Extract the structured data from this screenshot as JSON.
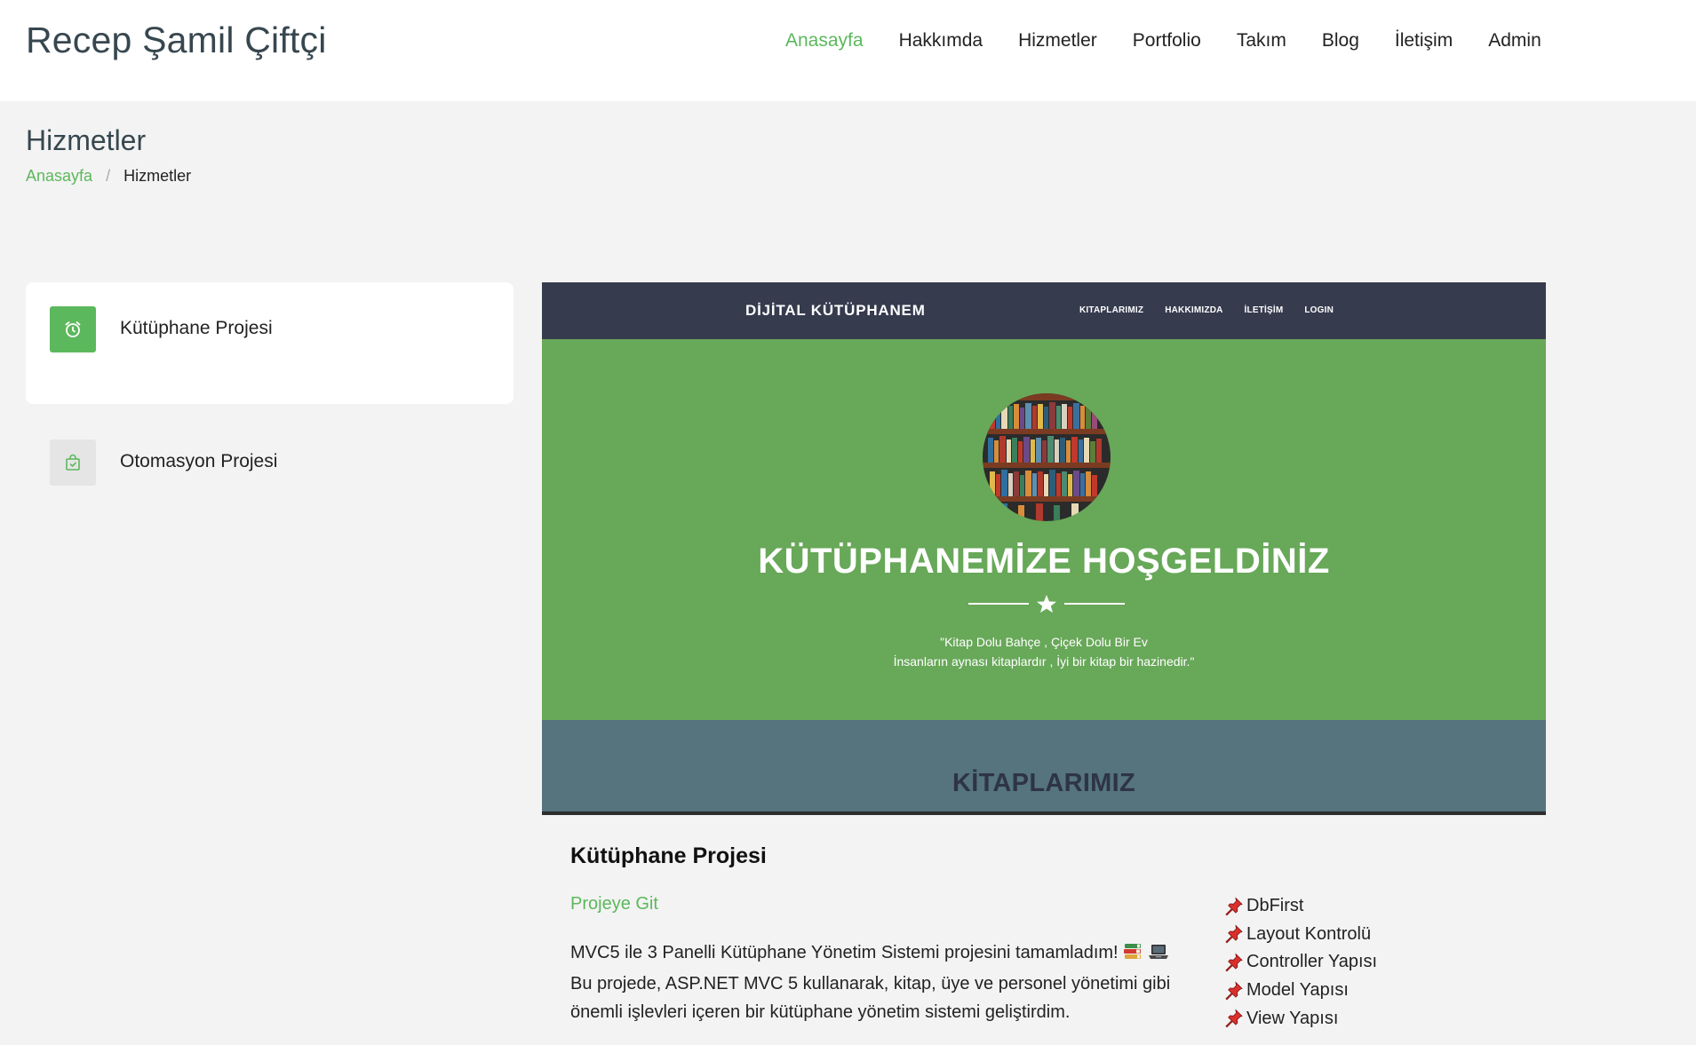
{
  "header": {
    "brand": "Recep Şamil Çiftçi",
    "nav": [
      {
        "label": "Anasayfa",
        "active": true
      },
      {
        "label": "Hakkımda",
        "active": false
      },
      {
        "label": "Hizmetler",
        "active": false
      },
      {
        "label": "Portfolio",
        "active": false
      },
      {
        "label": "Takım",
        "active": false
      },
      {
        "label": "Blog",
        "active": false
      },
      {
        "label": "İletişim",
        "active": false
      },
      {
        "label": "Admin",
        "active": false
      }
    ]
  },
  "page": {
    "title": "Hizmetler",
    "breadcrumb": {
      "home": "Anasayfa",
      "separator": "/",
      "current": "Hizmetler"
    }
  },
  "sidebar": {
    "items": [
      {
        "label": "Kütüphane Projesi",
        "icon": "alarm-clock-icon",
        "active": true
      },
      {
        "label": "Otomasyon Projesi",
        "icon": "shopping-bag-check-icon",
        "active": false
      }
    ]
  },
  "screenshot": {
    "brand": "DİJİTAL KÜTÜPHANEM",
    "menu": [
      "KITAPLARIMIZ",
      "HAKKIMIZDA",
      "İLETİŞİM",
      "LOGIN"
    ],
    "hero_title": "KÜTÜPHANEMİZE HOŞGELDİNİZ",
    "quote_line1": "\"Kitap Dolu Bahçe , Çiçek Dolu Bir Ev",
    "quote_line2": "İnsanların aynası kitaplardır , İyi bir kitap bir hazinedir.\"",
    "section_title": "KİTAPLARIMIZ"
  },
  "project": {
    "title": "Kütüphane Projesi",
    "link": "Projeye Git",
    "desc_part1": "MVC5 ile 3 Panelli Kütüphane Yönetim Sistemi projesini tamamladım!",
    "desc_part2": "Bu projede, ASP.NET MVC 5 kullanarak, kitap, üye ve personel yönetimi gibi önemli işlevleri içeren bir kütüphane yönetim sistemi geliştirdim.",
    "features": [
      "DbFirst",
      "Layout Kontrolü",
      "Controller Yapısı",
      "Model Yapısı",
      "View Yapısı"
    ]
  },
  "colors": {
    "accent": "#5cb85c",
    "hero_green": "#68a859",
    "nav_dark": "#363b4e",
    "section_teal": "#55747d"
  }
}
